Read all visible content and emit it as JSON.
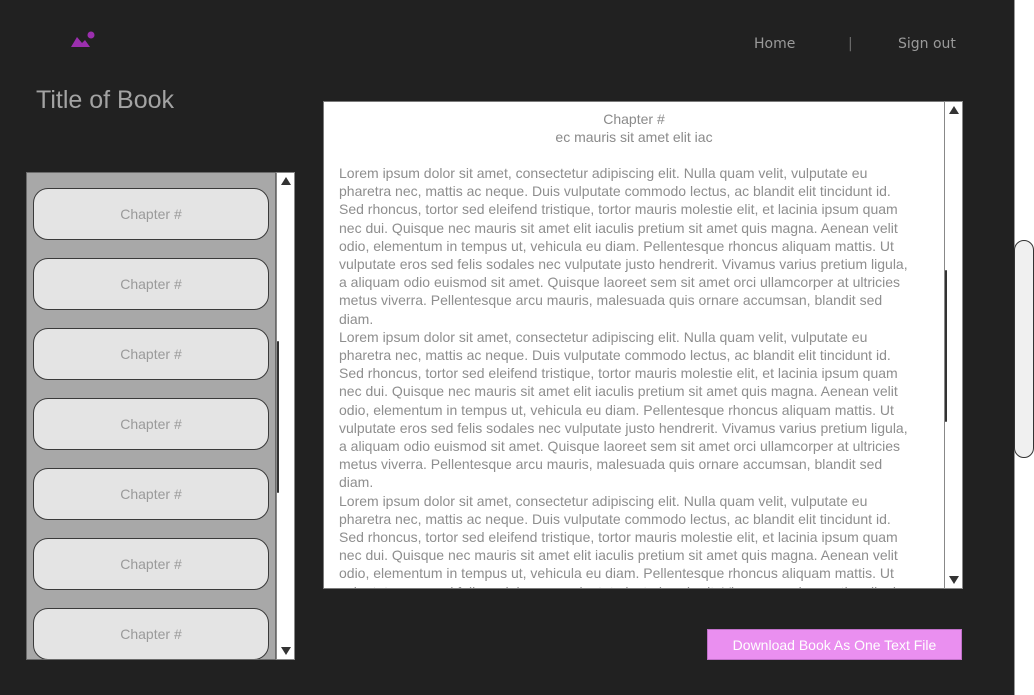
{
  "header": {
    "logo_icon": "image-icon",
    "accent_color": "#9b2fae",
    "nav": {
      "home": "Home",
      "separator": "|",
      "sign_out": "Sign out"
    }
  },
  "book": {
    "title": "Title of Book"
  },
  "chapters": [
    "Chapter #",
    "Chapter #",
    "Chapter #",
    "Chapter #",
    "Chapter #",
    "Chapter #",
    "Chapter #"
  ],
  "reader": {
    "chapter_title": "Chapter #",
    "chapter_subtitle": "ec mauris sit amet elit iac",
    "paragraphs": [
      "Lorem ipsum dolor sit amet, consectetur adipiscing elit. Nulla quam velit, vulputate eu pharetra nec, mattis ac neque. Duis vulputate commodo lectus, ac blandit elit tincidunt id. Sed rhoncus, tortor sed eleifend tristique, tortor mauris molestie elit, et lacinia ipsum quam nec dui. Quisque nec mauris sit amet elit iaculis pretium sit amet quis magna. Aenean velit odio, elementum in tempus ut, vehicula eu diam. Pellentesque rhoncus aliquam mattis. Ut vulputate eros sed felis sodales nec vulputate justo hendrerit. Vivamus varius pretium ligula, a aliquam odio euismod sit amet. Quisque laoreet sem sit amet orci ullamcorper at ultricies metus viverra. Pellentesque arcu mauris, malesuada quis ornare accumsan, blandit sed diam.",
      "Lorem ipsum dolor sit amet, consectetur adipiscing elit. Nulla quam velit, vulputate eu pharetra nec, mattis ac neque. Duis vulputate commodo lectus, ac blandit elit tincidunt id. Sed rhoncus, tortor sed eleifend tristique, tortor mauris molestie elit, et lacinia ipsum quam nec dui. Quisque nec mauris sit amet elit iaculis pretium sit amet quis magna. Aenean velit odio, elementum in tempus ut, vehicula eu diam. Pellentesque rhoncus aliquam mattis. Ut vulputate eros sed felis sodales nec vulputate justo hendrerit. Vivamus varius pretium ligula, a aliquam odio euismod sit amet. Quisque laoreet sem sit amet orci ullamcorper at ultricies metus viverra. Pellentesque arcu mauris, malesuada quis ornare accumsan, blandit sed diam.",
      "Lorem ipsum dolor sit amet, consectetur adipiscing elit. Nulla quam velit, vulputate eu pharetra nec, mattis ac neque. Duis vulputate commodo lectus, ac blandit elit tincidunt id. Sed rhoncus, tortor sed eleifend tristique, tortor mauris molestie elit, et lacinia ipsum quam nec dui. Quisque nec mauris sit amet elit iaculis pretium sit amet quis magna. Aenean velit odio, elementum in tempus ut, vehicula eu diam. Pellentesque rhoncus aliquam mattis. Ut vulputate eros sed felis sodales nec vulputate justo hendrerit. Vivamus varius pretium ligula,"
    ]
  },
  "download": {
    "label": "Download Book As One Text File",
    "color": "#ea8ff0"
  }
}
